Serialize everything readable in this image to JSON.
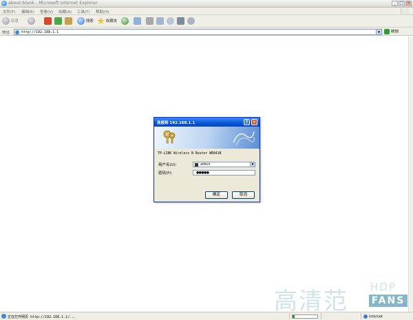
{
  "window": {
    "title": "about:blank - Microsoft Internet Explorer",
    "controls": {
      "minimize": "_",
      "maximize": "□",
      "close": "×"
    }
  },
  "menu": {
    "items": [
      "文件(F)",
      "编辑(E)",
      "查看(V)",
      "收藏(A)",
      "工具(T)",
      "帮助(H)"
    ]
  },
  "toolbar": {
    "back_label": "后退",
    "search_label": "搜索",
    "favorites_label": "收藏夹",
    "icons": [
      "back-icon",
      "forward-icon",
      "stop-icon",
      "refresh-icon",
      "home-icon",
      "search-icon",
      "favorites-icon",
      "history-icon",
      "mail-icon",
      "print-icon",
      "edit-icon",
      "discuss-icon",
      "messenger-icon"
    ]
  },
  "address": {
    "label": "地址",
    "url": "http://192.168.1.1",
    "go_label": "转到"
  },
  "dialog": {
    "title": "连接到 192.168.1.1",
    "prompt": "TP-LINK Wireless N Router WR841N",
    "username_label": "用户名(U):",
    "username_value": "admin",
    "password_label": "密码(P):",
    "password_value": "●●●●●",
    "ok_label": "确定",
    "cancel_label": "取消"
  },
  "status": {
    "text": "正在打开网页 http://192.168.1.1/...",
    "zone": "Internet",
    "progress": 0.08
  },
  "watermark": {
    "text": "高清范",
    "hdp": "HDP",
    "fans": "FANS"
  },
  "colors": {
    "dialog_title": "#0a54d4",
    "close_button": "#d9502b",
    "chrome": "#efefe8",
    "watermark": "#86b7c8"
  }
}
